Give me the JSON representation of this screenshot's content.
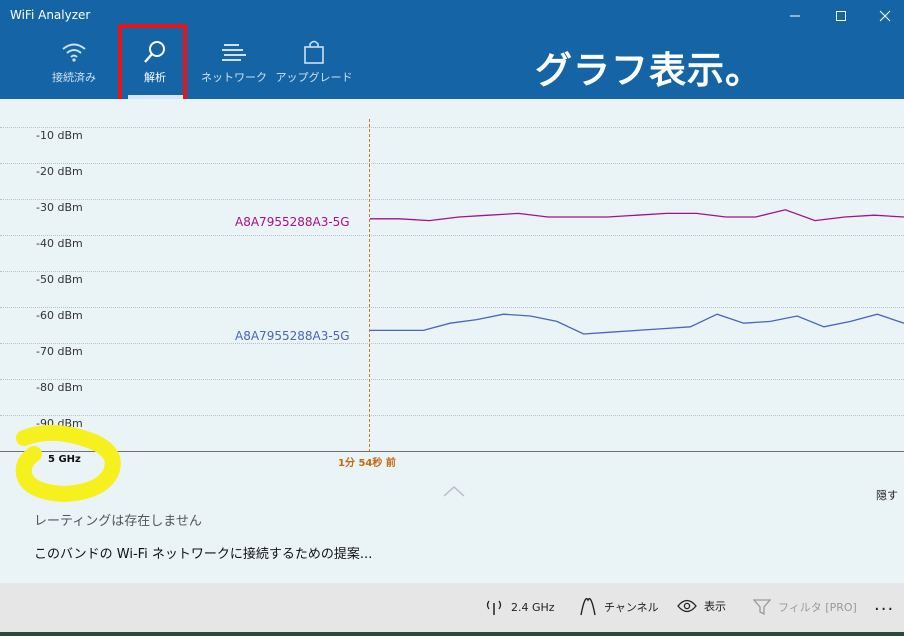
{
  "window": {
    "title": "WiFi Analyzer",
    "controls": [
      "minimize",
      "maximize",
      "close"
    ]
  },
  "nav": {
    "tabs": [
      {
        "label": "接続済み",
        "icon": "wifi-icon",
        "active": false
      },
      {
        "label": "解析",
        "icon": "analyze-icon",
        "active": true
      },
      {
        "label": "ネットワーク",
        "icon": "network-list-icon",
        "active": false
      },
      {
        "label": "アップグレード",
        "icon": "shopping-bag-icon",
        "active": false
      }
    ]
  },
  "banner": "グラフ表示。",
  "graph": {
    "band": "5 GHz",
    "time_marker": "1分 54秒 前",
    "y_axis_labels": [
      "-10 dBm",
      "-20 dBm",
      "-30 dBm",
      "-40 dBm",
      "-50 dBm",
      "-60 dBm",
      "-70 dBm",
      "-80 dBm",
      "-90 dBm"
    ]
  },
  "chart_data": {
    "type": "line",
    "ylim": [
      -100,
      -5
    ],
    "series": [
      {
        "name": "A8A7955288A3-5G",
        "color": "#a5108c",
        "values": [
          -35.5,
          -35.5,
          -36,
          -35,
          -34.5,
          -34,
          -35,
          -35,
          -35,
          -34.5,
          -34,
          -34,
          -35,
          -35,
          -33,
          -36,
          -35,
          -34.5,
          -35
        ]
      },
      {
        "name": "A8A7955288A3-5G",
        "color": "#4a64c0",
        "values": [
          -66.5,
          -66.5,
          -66.5,
          -64.5,
          -63.5,
          -62,
          -62.5,
          -64,
          -67.5,
          -67,
          -66.5,
          -66,
          -65.5,
          -62,
          -64.5,
          -64,
          -62.5,
          -65.5,
          -64,
          -62,
          -64.5
        ]
      }
    ]
  },
  "bottom_panel": {
    "hide_label": "隠す",
    "rating_text": "レーティングは存在しません",
    "suggestion_text": "このバンドの Wi-Fi ネットワークに接続するための提案..."
  },
  "bottom_bar": {
    "band_label": "2.4 GHz",
    "channel_label": "チャンネル",
    "view_label": "表示",
    "filter_label": "フィルタ [PRO]",
    "more_label": "..."
  },
  "colors": {
    "header": "#1565a6",
    "accent_annotation": "#e8141c",
    "highlight_annotation": "#f6f01e",
    "time_marker": "#d7751b"
  }
}
